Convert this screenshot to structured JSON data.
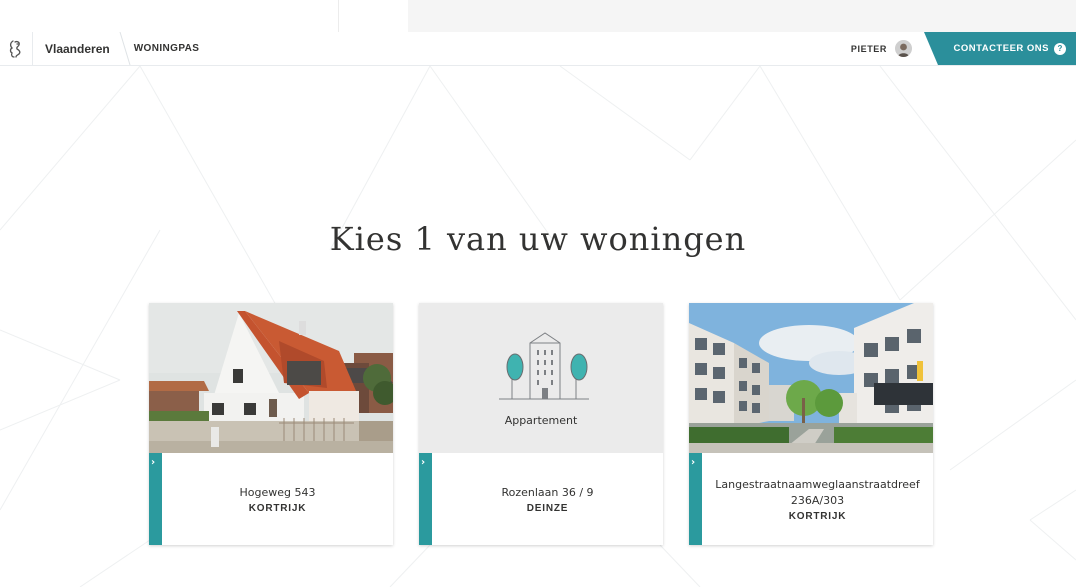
{
  "header": {
    "brand": "Vlaanderen",
    "app_name": "WONINGPAS",
    "user_name": "PIETER",
    "contact_label": "CONTACTEER ONS",
    "help_glyph": "?",
    "accent_color": "#2b8f9b"
  },
  "main": {
    "title": "Kies 1 van uw woningen",
    "cards": [
      {
        "address": "Hogeweg 543",
        "city": "KORTRIJK",
        "image": "photo-house"
      },
      {
        "address": "Rozenlaan 36 / 9",
        "city": "DEINZE",
        "image": "apartment-icon",
        "image_label": "Appartement"
      },
      {
        "address": "Langestraatnaamweglaanstraatdreef 236A/303",
        "city": "KORTRIJK",
        "image": "photo-apartments"
      }
    ]
  },
  "icons": {
    "logo": "flemish-lion-icon",
    "avatar": "user-avatar",
    "help": "help-icon",
    "card_arrow": "chevron-right-icon"
  }
}
